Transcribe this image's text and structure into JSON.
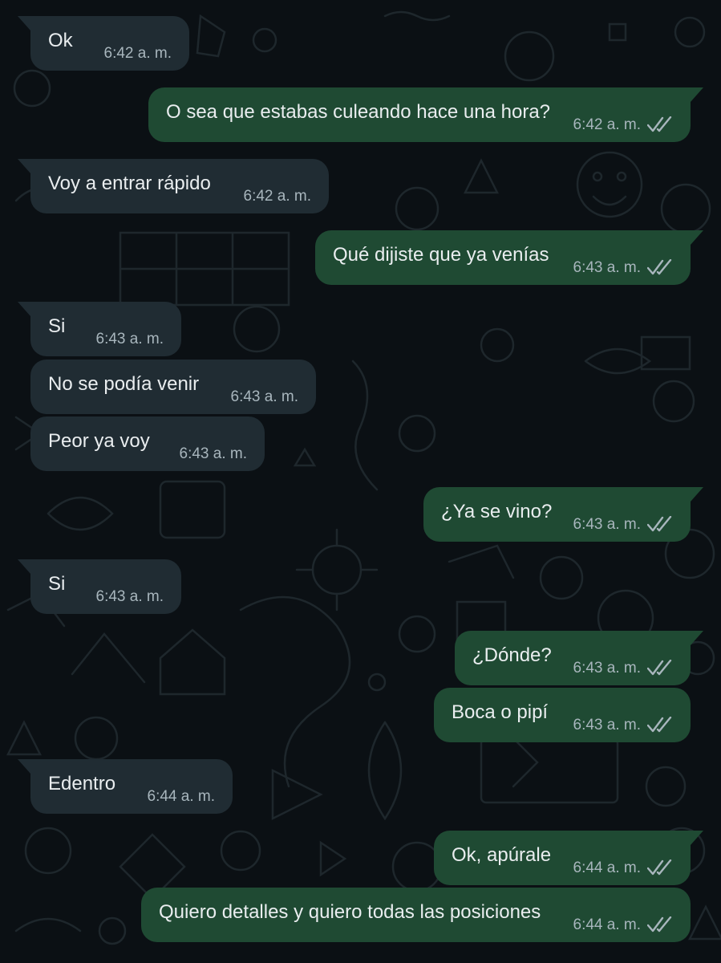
{
  "messages": [
    {
      "direction": "in",
      "text": "Ok",
      "time": "6:42 a. m."
    },
    {
      "direction": "out",
      "text": "O sea que estabas culeando hace una hora?",
      "time": "6:42 a. m.",
      "status_icon": "double-check-icon"
    },
    {
      "direction": "in",
      "text": "Voy a entrar rápido",
      "time": "6:42 a. m."
    },
    {
      "direction": "out",
      "text": "Qué dijiste que ya venías",
      "time": "6:43 a. m.",
      "status_icon": "double-check-icon"
    },
    {
      "direction": "in",
      "text": "Si",
      "time": "6:43 a. m."
    },
    {
      "direction": "in",
      "text": "No se podía venir",
      "time": "6:43 a. m."
    },
    {
      "direction": "in",
      "text": "Peor ya voy",
      "time": "6:43 a. m."
    },
    {
      "direction": "out",
      "text": "¿Ya se vino?",
      "time": "6:43 a. m.",
      "status_icon": "double-check-icon"
    },
    {
      "direction": "in",
      "text": "Si",
      "time": "6:43 a. m."
    },
    {
      "direction": "out",
      "text": "¿Dónde?",
      "time": "6:43 a. m.",
      "status_icon": "double-check-icon"
    },
    {
      "direction": "out",
      "text": "Boca o pipí",
      "time": "6:43 a. m.",
      "status_icon": "double-check-icon"
    },
    {
      "direction": "in",
      "text": "Edentro",
      "time": "6:44 a. m."
    },
    {
      "direction": "out",
      "text": "Ok, apúrale",
      "time": "6:44 a. m.",
      "status_icon": "double-check-icon"
    },
    {
      "direction": "out",
      "text": "Quiero detalles y quiero todas las posiciones",
      "time": "6:44 a. m.",
      "status_icon": "double-check-icon"
    }
  ],
  "colors": {
    "background": "#0b1014",
    "incoming_bubble": "#202c33",
    "outgoing_bubble": "#1f4a33",
    "text": "#e9edef",
    "timestamp": "#a8b6bd"
  }
}
